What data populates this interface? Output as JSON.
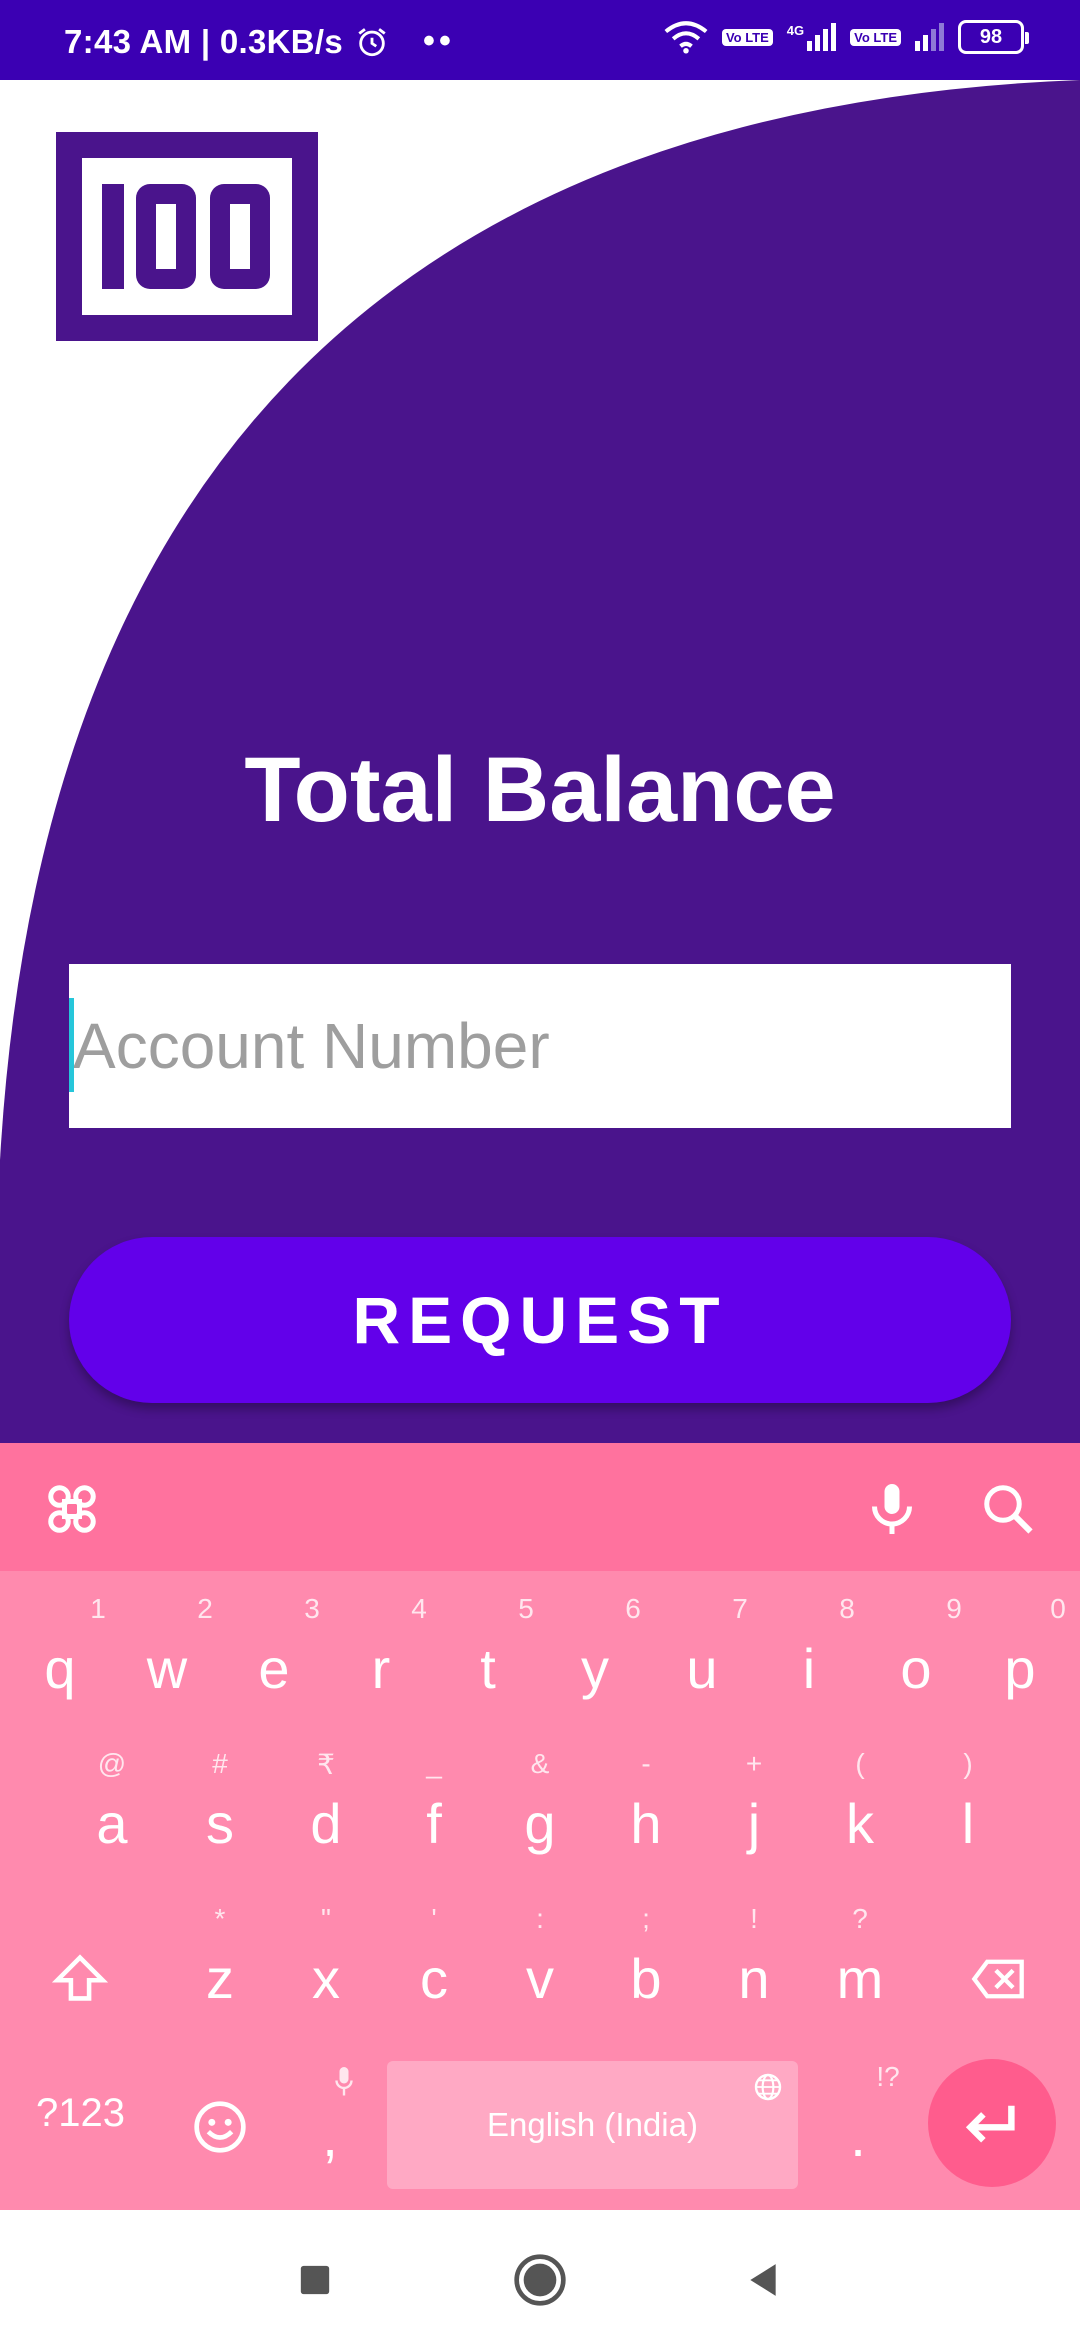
{
  "status_bar": {
    "time": "7:43 AM | 0.3KB/s",
    "dots": "••",
    "volte_label": "Vo LTE",
    "network_label": "4G",
    "battery": "98"
  },
  "app": {
    "logo_text": "100",
    "title": "Total Balance",
    "account_placeholder": "Account Number",
    "request_label": "REQUEST",
    "colors": {
      "status": "#3b00b3",
      "background": "#4a148c",
      "button": "#6200ea"
    }
  },
  "keyboard": {
    "row1": [
      {
        "key": "q",
        "hint": "1"
      },
      {
        "key": "w",
        "hint": "2"
      },
      {
        "key": "e",
        "hint": "3"
      },
      {
        "key": "r",
        "hint": "4"
      },
      {
        "key": "t",
        "hint": "5"
      },
      {
        "key": "y",
        "hint": "6"
      },
      {
        "key": "u",
        "hint": "7"
      },
      {
        "key": "i",
        "hint": "8"
      },
      {
        "key": "o",
        "hint": "9"
      },
      {
        "key": "p",
        "hint": "0"
      }
    ],
    "row2": [
      {
        "key": "a",
        "hint": "@"
      },
      {
        "key": "s",
        "hint": "#"
      },
      {
        "key": "d",
        "hint": "₹"
      },
      {
        "key": "f",
        "hint": "_"
      },
      {
        "key": "g",
        "hint": "&"
      },
      {
        "key": "h",
        "hint": "-"
      },
      {
        "key": "j",
        "hint": "+"
      },
      {
        "key": "k",
        "hint": "("
      },
      {
        "key": "l",
        "hint": ")"
      }
    ],
    "row3": [
      {
        "key": "z",
        "hint": "*"
      },
      {
        "key": "x",
        "hint": "\""
      },
      {
        "key": "c",
        "hint": "'"
      },
      {
        "key": "v",
        "hint": ":"
      },
      {
        "key": "b",
        "hint": ";"
      },
      {
        "key": "n",
        "hint": "!"
      },
      {
        "key": "m",
        "hint": "?"
      }
    ],
    "symbols_label": "?123",
    "comma": ",",
    "period": ".",
    "period_hint": "!?",
    "space_label": "English (India)",
    "colors": {
      "base": "#ff8aae",
      "toolbar": "#ff729e",
      "enter": "#ff5c8d"
    }
  }
}
